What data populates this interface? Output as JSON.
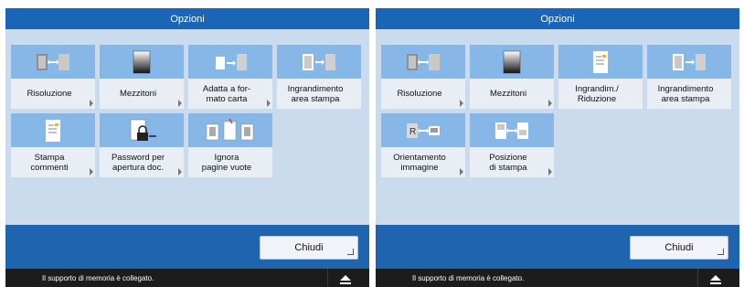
{
  "screens": [
    {
      "title": "Opzioni",
      "tiles": [
        {
          "label": "Risoluzione",
          "icon": "resolution-icon"
        },
        {
          "label": "Mezzitoni",
          "icon": "halftone-icon"
        },
        {
          "label": "Adatta a for-\nmato carta",
          "icon": "fit-to-paper-icon"
        },
        {
          "label": "Ingrandimento\narea stampa",
          "icon": "enlarge-print-area-icon"
        },
        {
          "label": "Stampa\ncommenti",
          "icon": "print-comments-icon"
        },
        {
          "label": "Password per\napertura doc.",
          "icon": "document-password-icon"
        },
        {
          "label": "Ignora\npagine vuote",
          "icon": "skip-blank-pages-icon"
        }
      ],
      "close_label": "Chiudi",
      "status_text": "Il supporto di memoria è collegato."
    },
    {
      "title": "Opzioni",
      "tiles": [
        {
          "label": "Risoluzione",
          "icon": "resolution-icon"
        },
        {
          "label": "Mezzitoni",
          "icon": "halftone-icon"
        },
        {
          "label": "Ingrandim./\nRiduzione",
          "icon": "zoom-icon"
        },
        {
          "label": "Ingrandimento\narea stampa",
          "icon": "enlarge-print-area-icon"
        },
        {
          "label": "Orientamento\nimmagine",
          "icon": "image-orientation-icon"
        },
        {
          "label": "Posizione\ndi stampa",
          "icon": "print-position-icon"
        }
      ],
      "close_label": "Chiudi",
      "status_text": "Il supporto di memoria è collegato."
    }
  ],
  "colors": {
    "title_bar": "#1a65b5",
    "panel_bg": "#c9dbed",
    "tile_icon_bg": "#86b7e6",
    "footer_bar": "#1e64af",
    "status_bar": "#1c1c1c"
  }
}
